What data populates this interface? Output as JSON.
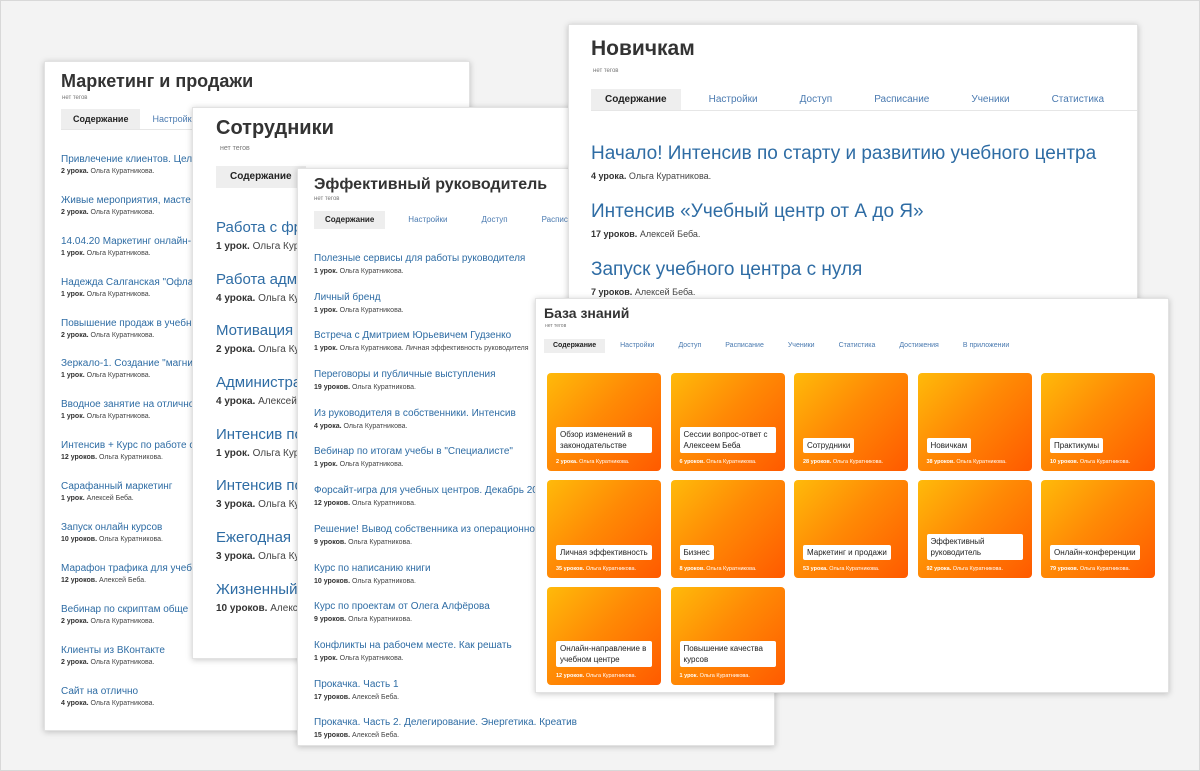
{
  "marketing": {
    "title": "Маркетинг и продажи",
    "tags": "нет тегов",
    "tabs": [
      "Содержание",
      "Настройки"
    ],
    "items": [
      {
        "title": "Привлечение клиентов. Цел",
        "count": "2 урока.",
        "author": "Ольга Куратникова."
      },
      {
        "title": "Живые мероприятия, масте",
        "count": "2 урока.",
        "author": "Ольга Куратникова."
      },
      {
        "title": "14.04.20 Маркетинг онлайн-",
        "count": "1 урок.",
        "author": "Ольга Куратникова."
      },
      {
        "title": "Надежда Салганская \"Офла",
        "count": "1 урок.",
        "author": "Ольга Куратникова."
      },
      {
        "title": "Повышение продаж в учебн",
        "count": "2 урока.",
        "author": "Ольга Куратникова."
      },
      {
        "title": "Зеркало-1. Создание \"магни",
        "count": "1 урок.",
        "author": "Ольга Куратникова."
      },
      {
        "title": "Вводное занятие на отлично",
        "count": "1 урок.",
        "author": "Ольга Куратникова."
      },
      {
        "title": "Интенсив + Курс по работе с",
        "count": "12 уроков.",
        "author": "Ольга Куратникова."
      },
      {
        "title": "Сарафанный маркетинг",
        "count": "1 урок.",
        "author": "Алексей Беба."
      },
      {
        "title": "Запуск онлайн курсов",
        "count": "10 уроков.",
        "author": "Ольга Куратникова."
      },
      {
        "title": "Марафон трафика для учеб",
        "count": "12 уроков.",
        "author": "Алексей Беба."
      },
      {
        "title": "Вебинар по скриптам обще",
        "count": "2 урока.",
        "author": "Ольга Куратникова."
      },
      {
        "title": "Клиенты из ВКонтакте",
        "count": "2 урока.",
        "author": "Ольга Куратникова."
      },
      {
        "title": "Сайт на отлично",
        "count": "4 урока.",
        "author": "Ольга Куратникова."
      }
    ]
  },
  "employees": {
    "title": "Сотрудники",
    "tags": "нет тегов",
    "tabs": [
      "Содержание"
    ],
    "items": [
      {
        "title": "Работа с фр",
        "count": "1 урок.",
        "author": "Ольга Кур"
      },
      {
        "title": "Работа адми",
        "count": "4 урока.",
        "author": "Ольга Кур"
      },
      {
        "title": "Мотивация",
        "count": "2 урока.",
        "author": "Ольга Кур"
      },
      {
        "title": "Администра",
        "count": "4 урока.",
        "author": "Алексей"
      },
      {
        "title": "Интенсив по",
        "count": "1 урок.",
        "author": "Ольга Кур"
      },
      {
        "title": "Интенсив по",
        "count": "3 урока.",
        "author": "Ольга Кур"
      },
      {
        "title": "Ежегодная",
        "count": "3 урока.",
        "author": "Ольга Кур"
      },
      {
        "title": "Жизненный",
        "count": "10 уроков.",
        "author": "Алекс"
      }
    ]
  },
  "manager": {
    "title": "Эффективный руководитель",
    "tags": "нет тегов",
    "tabs": [
      "Содержание",
      "Настройки",
      "Доступ",
      "Расписание"
    ],
    "items": [
      {
        "title": "Полезные сервисы для работы руководителя",
        "count": "1 урок.",
        "author": "Ольга Куратникова."
      },
      {
        "title": "Личный бренд",
        "count": "1 урок.",
        "author": "Ольга Куратникова."
      },
      {
        "title": "Встреча с Дмитрием Юрьевичем Гудзенко",
        "count": "1 урок.",
        "author": "Ольга Куратникова. Личная эффективность руководителя"
      },
      {
        "title": "Переговоры и публичные выступления",
        "count": "19 уроков.",
        "author": "Ольга Куратникова."
      },
      {
        "title": "Из руководителя в собственники. Интенсив",
        "count": "4 урока.",
        "author": "Ольга Куратникова."
      },
      {
        "title": "Вебинар по итогам учебы в \"Специалисте\"",
        "count": "1 урок.",
        "author": "Ольга Куратникова."
      },
      {
        "title": "Форсайт-игра для учебных центров. Декабрь 2019",
        "count": "12 уроков.",
        "author": "Ольга Куратникова."
      },
      {
        "title": "Решение! Вывод собственника из операционной",
        "count": "9 уроков.",
        "author": "Ольга Куратникова."
      },
      {
        "title": "Курс по написанию книги",
        "count": "10 уроков.",
        "author": "Ольга Куратникова."
      },
      {
        "title": "Курс по проектам от Олега Алфёрова",
        "count": "9 уроков.",
        "author": "Ольга Куратникова."
      },
      {
        "title": "Конфликты на рабочем месте. Как решать",
        "count": "1 урок.",
        "author": "Ольга Куратникова."
      },
      {
        "title": "Прокачка. Часть 1",
        "count": "17 уроков.",
        "author": "Алексей Беба."
      },
      {
        "title": "Прокачка. Часть 2. Делегирование. Энергетика. Креатив",
        "count": "15 уроков.",
        "author": "Алексей Беба."
      }
    ]
  },
  "newbies": {
    "title": "Новичкам",
    "tags": "нет тегов",
    "tabs": [
      "Содержание",
      "Настройки",
      "Доступ",
      "Расписание",
      "Ученики",
      "Статистика"
    ],
    "items": [
      {
        "title": "Начало! Интенсив по старту и развитию учебного центра",
        "count": "4 урока.",
        "author": "Ольга Куратникова."
      },
      {
        "title": "Интенсив «Учебный центр от А до Я»",
        "count": "17 уроков.",
        "author": "Алексей Беба."
      },
      {
        "title": "Запуск учебного центра с нуля",
        "count": "7 уроков.",
        "author": "Алексей Беба."
      }
    ]
  },
  "knowledge": {
    "title": "База знаний",
    "tags": "нет тегов",
    "tabs": [
      "Содержание",
      "Настройки",
      "Доступ",
      "Расписание",
      "Ученики",
      "Статистика",
      "Достижения",
      "В приложении"
    ],
    "tiles": [
      {
        "label": "Обзор изменений в законодательстве",
        "count": "2 урока.",
        "author": "Ольга Куратникова."
      },
      {
        "label": "Сессии вопрос-ответ с Алексеем Беба",
        "count": "6 уроков.",
        "author": "Ольга Куратникова."
      },
      {
        "label": "Сотрудники",
        "count": "28 уроков.",
        "author": "Ольга Куратникова."
      },
      {
        "label": "Новичкам",
        "count": "38 уроков.",
        "author": "Ольга Куратникова."
      },
      {
        "label": "Практикумы",
        "count": "10 уроков.",
        "author": "Ольга Куратникова."
      },
      {
        "label": "Личная эффективность",
        "count": "35 уроков.",
        "author": "Ольга Куратникова."
      },
      {
        "label": "Бизнес",
        "count": "8 уроков.",
        "author": "Ольга Куратникова."
      },
      {
        "label": "Маркетинг и продажи",
        "count": "53 урока.",
        "author": "Ольга Куратникова."
      },
      {
        "label": "Эффективный руководитель",
        "count": "92 урока.",
        "author": "Ольга Куратникова."
      },
      {
        "label": "Онлайн-конференции",
        "count": "79 уроков.",
        "author": "Ольга Куратникова."
      },
      {
        "label": "Онлайн-направление в учебном центре",
        "count": "12 уроков.",
        "author": "Ольга Куратникова."
      },
      {
        "label": "Повышение качества курсов",
        "count": "1 урок.",
        "author": "Ольга Куратникова."
      }
    ]
  }
}
